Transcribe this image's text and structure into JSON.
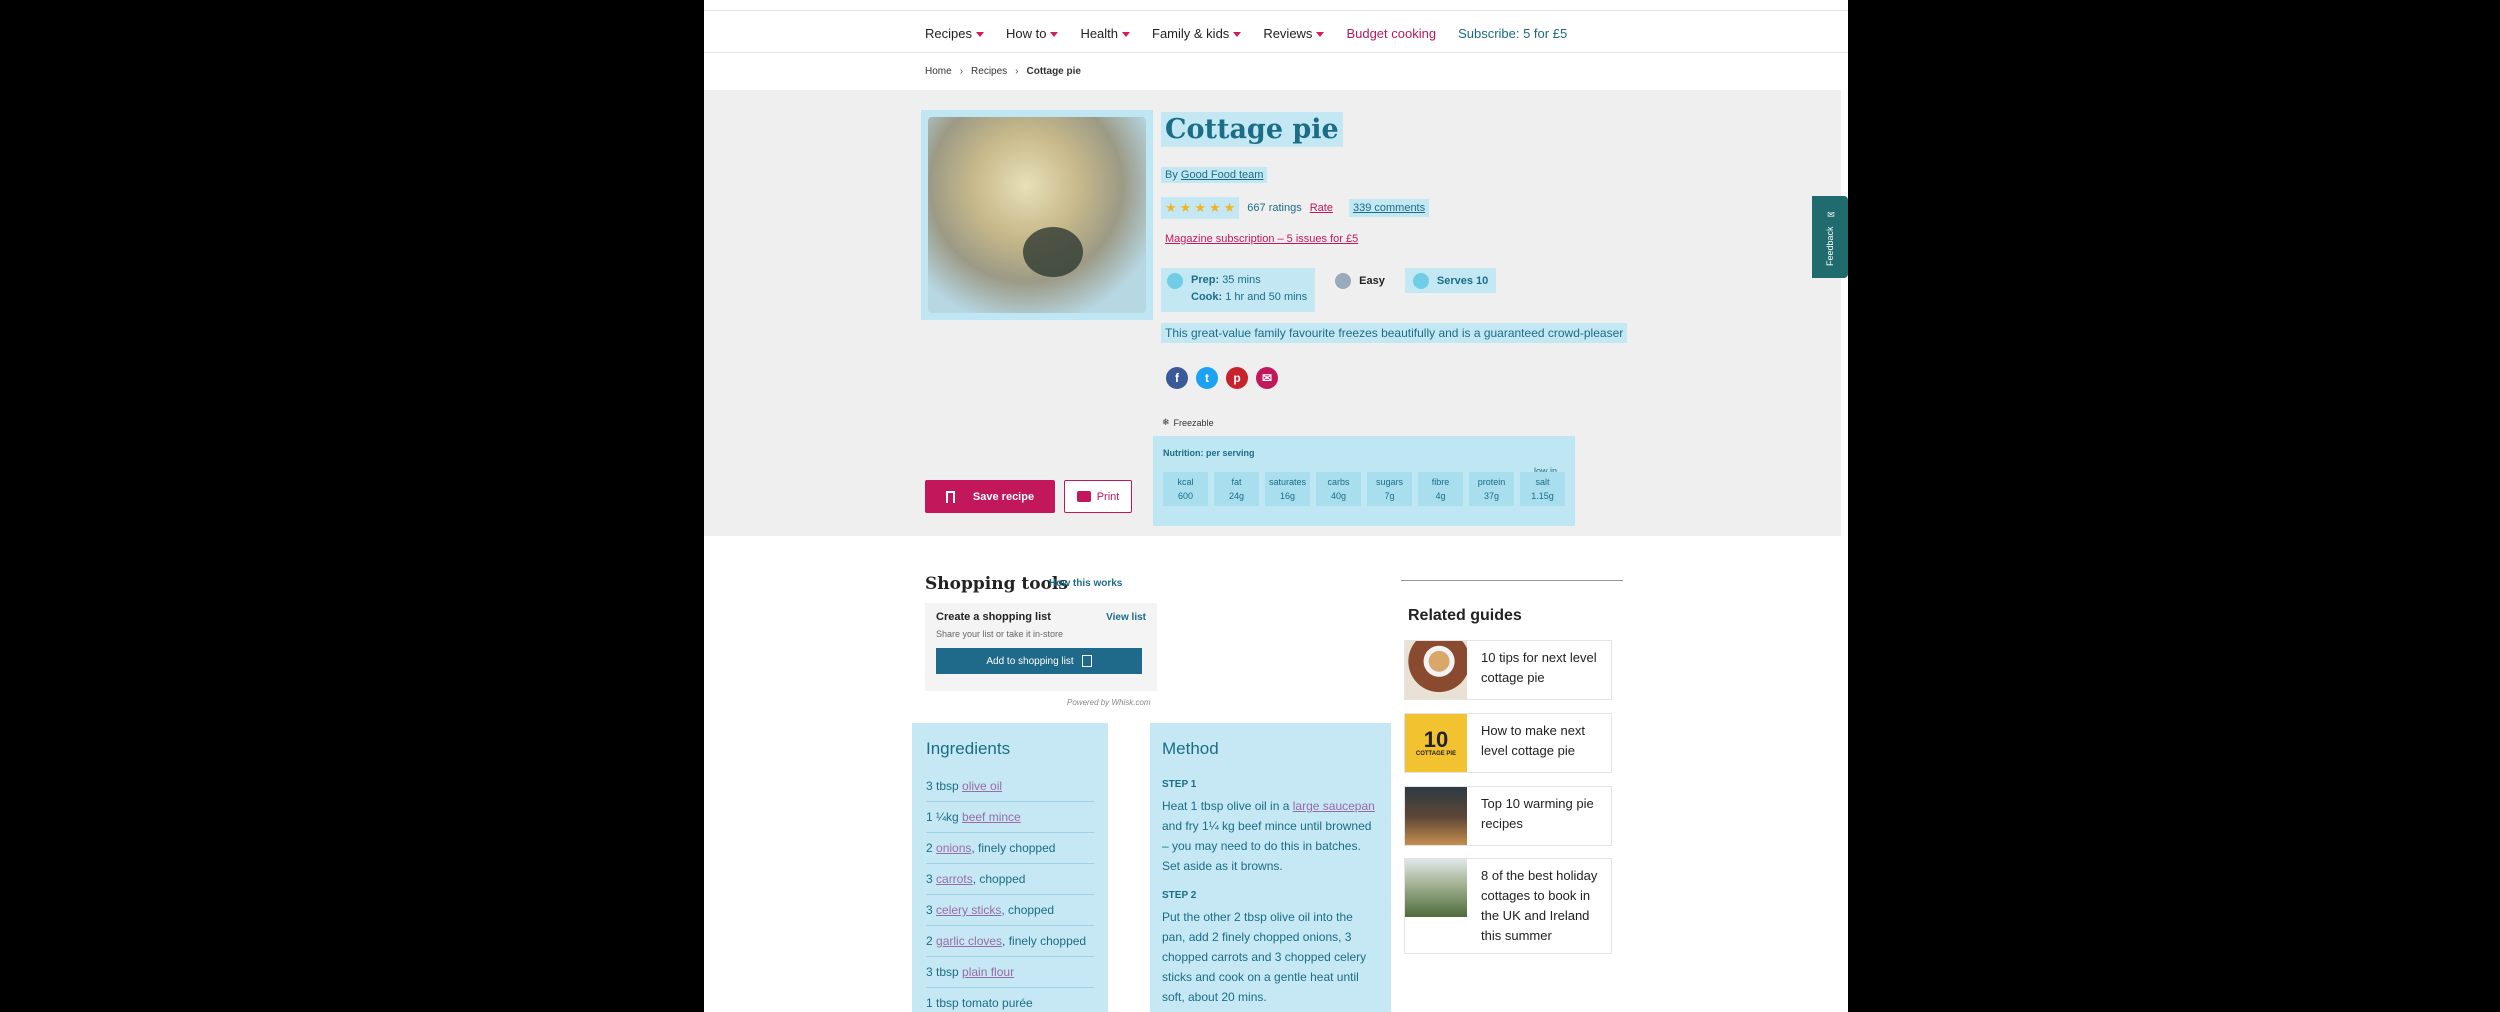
{
  "nav": {
    "items": [
      "Recipes",
      "How to",
      "Health",
      "Family & kids",
      "Reviews"
    ],
    "budget": "Budget cooking",
    "subscribe": "Subscribe: 5 for £5"
  },
  "breadcrumb": [
    "Home",
    "Recipes",
    "Cottage pie"
  ],
  "recipe": {
    "title": "Cottage pie",
    "by_prefix": "By",
    "author": "Good Food team",
    "ratings": "667 ratings",
    "rate": "Rate",
    "comments": "339 comments",
    "magazine": "Magazine subscription – 5 issues for £5",
    "prep_label": "Prep:",
    "prep": "35 mins",
    "cook_label": "Cook:",
    "cook": "1 hr and 50 mins",
    "difficulty": "Easy",
    "serves": "Serves 10",
    "description": "This great-value family favourite freezes beautifully and is a guaranteed crowd-pleaser",
    "freezable": "Freezable",
    "save": "Save recipe",
    "print": "Print"
  },
  "nutrition": {
    "heading": "Nutrition: per serving",
    "low_in": "low in",
    "items": [
      {
        "label": "kcal",
        "value": "600"
      },
      {
        "label": "fat",
        "value": "24g"
      },
      {
        "label": "saturates",
        "value": "16g"
      },
      {
        "label": "carbs",
        "value": "40g"
      },
      {
        "label": "sugars",
        "value": "7g"
      },
      {
        "label": "fibre",
        "value": "4g"
      },
      {
        "label": "protein",
        "value": "37g"
      },
      {
        "label": "salt",
        "value": "1.15g"
      }
    ]
  },
  "shopping": {
    "title": "Shopping tools",
    "how": "How this works",
    "create": "Create a shopping list",
    "view": "View list",
    "share": "Share your list or take it in-store",
    "add": "Add to shopping list",
    "powered": "Powered by Whisk.com"
  },
  "ingredients": {
    "title": "Ingredients",
    "items": [
      {
        "pre": "3 tbsp ",
        "link": "olive oil",
        "post": ""
      },
      {
        "pre": "1 ¼kg ",
        "link": "beef mince",
        "post": ""
      },
      {
        "pre": "2 ",
        "link": "onions",
        "post": ", finely chopped"
      },
      {
        "pre": "3 ",
        "link": "carrots",
        "post": ", chopped"
      },
      {
        "pre": "3 ",
        "link": "celery sticks",
        "post": ", chopped"
      },
      {
        "pre": "2 ",
        "link": "garlic cloves",
        "post": ", finely chopped"
      },
      {
        "pre": "3 tbsp ",
        "link": "plain flour",
        "post": ""
      },
      {
        "pre": "1 tbsp tomato purée",
        "link": "",
        "post": ""
      }
    ]
  },
  "method": {
    "title": "Method",
    "step1_label": "STEP 1",
    "step1_pre": "Heat 1 tbsp olive oil in a ",
    "step1_link": "large saucepan",
    "step1_post": " and fry 1¼ kg beef mince until browned – you may need to do this in batches. Set aside as it browns.",
    "step2_label": "STEP 2",
    "step2": "Put the other 2 tbsp olive oil into the pan, add 2 finely chopped onions, 3 chopped carrots and 3 chopped celery sticks and cook on a gentle heat until soft, about 20 mins."
  },
  "related": {
    "title": "Related guides",
    "items": [
      "10 tips for next level cottage pie",
      "How to make next level cottage pie",
      "Top 10 warming pie recipes",
      "8 of the best holiday cottages to book in the UK and Ireland this summer"
    ],
    "thumb2_text": "10",
    "thumb2_sub": "COTTAGE PIE"
  },
  "feedback": "Feedback"
}
